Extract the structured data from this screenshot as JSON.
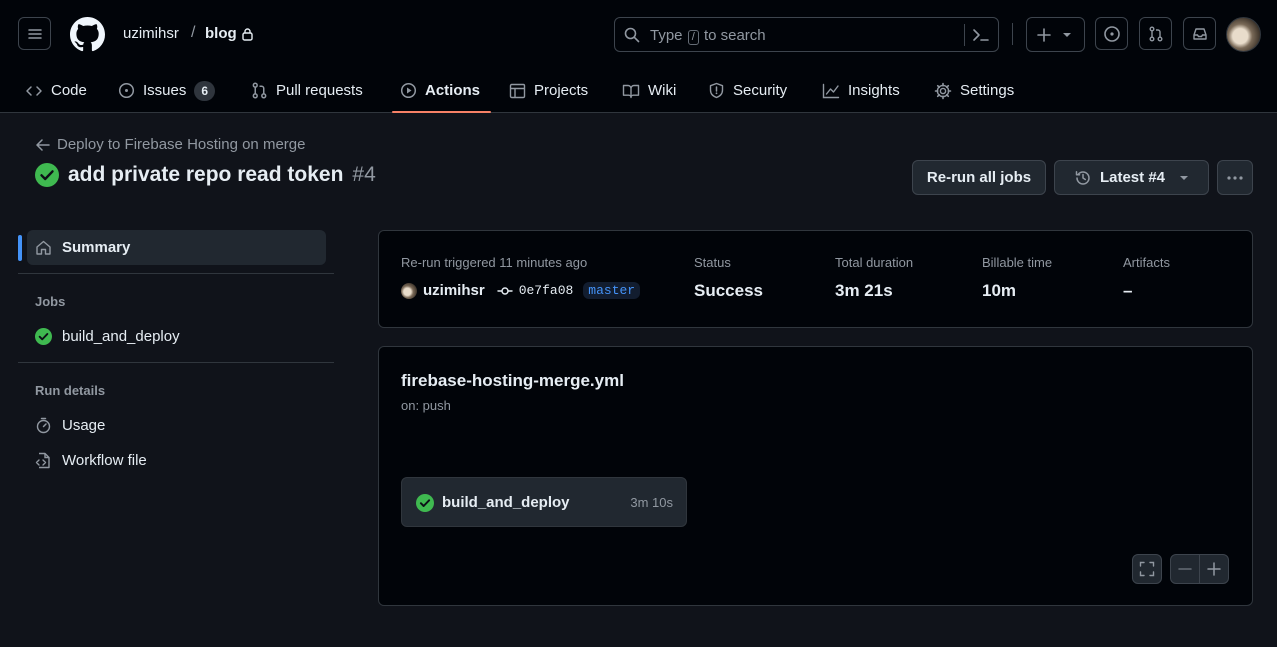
{
  "header": {
    "owner": "uzimihsr",
    "separator": "/",
    "repo": "blog",
    "search": {
      "prefix": "Type",
      "key": "/",
      "suffix": "to search"
    }
  },
  "nav": {
    "tabs": [
      {
        "label": "Code",
        "icon": "code-icon"
      },
      {
        "label": "Issues",
        "icon": "issue-icon",
        "count": "6"
      },
      {
        "label": "Pull requests",
        "icon": "pull-request-icon"
      },
      {
        "label": "Actions",
        "icon": "play-icon",
        "active": true
      },
      {
        "label": "Projects",
        "icon": "table-icon"
      },
      {
        "label": "Wiki",
        "icon": "book-icon"
      },
      {
        "label": "Security",
        "icon": "shield-icon"
      },
      {
        "label": "Insights",
        "icon": "graph-icon"
      },
      {
        "label": "Settings",
        "icon": "gear-icon"
      }
    ]
  },
  "run": {
    "back_label": "Deploy to Firebase Hosting on merge",
    "title": "add private repo read token",
    "number": "#4",
    "rerun_label": "Re-run all jobs",
    "attempt_label": "Latest #4"
  },
  "sidebar": {
    "summary_label": "Summary",
    "jobs_heading": "Jobs",
    "jobs": [
      {
        "label": "build_and_deploy"
      }
    ],
    "details_heading": "Run details",
    "details": [
      {
        "label": "Usage",
        "icon": "stopwatch-icon"
      },
      {
        "label": "Workflow file",
        "icon": "file-code-icon"
      }
    ]
  },
  "summary": {
    "trigger_text": "Re-run triggered 11 minutes ago",
    "actor": "uzimihsr",
    "commit_sha": "0e7fa08",
    "branch": "master",
    "status_label": "Status",
    "status_value": "Success",
    "duration_label": "Total duration",
    "duration_value": "3m 21s",
    "billable_label": "Billable time",
    "billable_value": "10m",
    "artifacts_label": "Artifacts",
    "artifacts_value": "–"
  },
  "workflow": {
    "file_name": "firebase-hosting-merge.yml",
    "trigger": "on: push",
    "job_name": "build_and_deploy",
    "job_duration": "3m 10s"
  },
  "colors": {
    "success": "#3fb950",
    "accent_underline": "#f78166",
    "link": "#4493f8"
  }
}
